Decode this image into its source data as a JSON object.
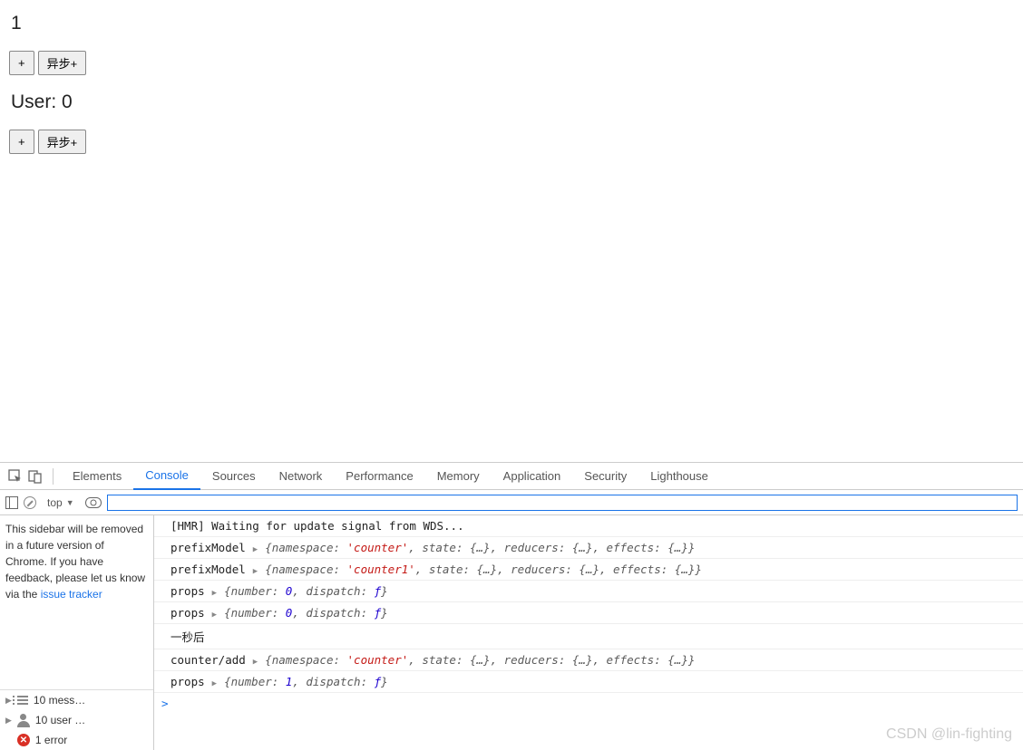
{
  "app": {
    "counter_value": "1",
    "counter_buttons": {
      "inc": "+",
      "async_inc": "异步+"
    },
    "user_label_prefix": "User: ",
    "user_value": "0",
    "user_buttons": {
      "inc": "+",
      "async_inc": "异步+"
    }
  },
  "devtools": {
    "tabs": [
      "Elements",
      "Console",
      "Sources",
      "Network",
      "Performance",
      "Memory",
      "Application",
      "Security",
      "Lighthouse"
    ],
    "active_tab": "Console",
    "toolbar": {
      "context_label": "top",
      "filter_value": ""
    },
    "sidebar": {
      "notice_text": "This sidebar will be removed in a future version of Chrome. If you have feedback, please let us know via the ",
      "notice_link": "issue tracker",
      "counts": {
        "messages": "10 mess…",
        "user": "10 user …",
        "errors": "1 error"
      }
    },
    "console_rows": [
      {
        "type": "plain",
        "text": "[HMR] Waiting for update signal from WDS..."
      },
      {
        "type": "obj",
        "label": "prefixModel",
        "preview": [
          [
            "key",
            "{namespace: "
          ],
          [
            "str",
            "'counter'"
          ],
          [
            "key",
            ", state: "
          ],
          [
            "punct",
            "{…}"
          ],
          [
            "key",
            ", reducers: "
          ],
          [
            "punct",
            "{…}"
          ],
          [
            "key",
            ", effects: "
          ],
          [
            "punct",
            "{…}"
          ],
          [
            "key",
            "}"
          ]
        ]
      },
      {
        "type": "obj",
        "label": "prefixModel",
        "preview": [
          [
            "key",
            "{namespace: "
          ],
          [
            "str",
            "'counter1'"
          ],
          [
            "key",
            ", state: "
          ],
          [
            "punct",
            "{…}"
          ],
          [
            "key",
            ", reducers: "
          ],
          [
            "punct",
            "{…}"
          ],
          [
            "key",
            ", effects: "
          ],
          [
            "punct",
            "{…}"
          ],
          [
            "key",
            "}"
          ]
        ]
      },
      {
        "type": "obj",
        "label": "props",
        "preview": [
          [
            "key",
            "{number: "
          ],
          [
            "num",
            "0"
          ],
          [
            "key",
            ", dispatch: "
          ],
          [
            "fn",
            "ƒ"
          ],
          [
            "key",
            "}"
          ]
        ]
      },
      {
        "type": "obj",
        "label": "props",
        "preview": [
          [
            "key",
            "{number: "
          ],
          [
            "num",
            "0"
          ],
          [
            "key",
            ", dispatch: "
          ],
          [
            "fn",
            "ƒ"
          ],
          [
            "key",
            "}"
          ]
        ]
      },
      {
        "type": "plain",
        "text": "一秒后"
      },
      {
        "type": "obj",
        "label": "counter/add",
        "preview": [
          [
            "key",
            "{namespace: "
          ],
          [
            "str",
            "'counter'"
          ],
          [
            "key",
            ", state: "
          ],
          [
            "punct",
            "{…}"
          ],
          [
            "key",
            ", reducers: "
          ],
          [
            "punct",
            "{…}"
          ],
          [
            "key",
            ", effects: "
          ],
          [
            "punct",
            "{…}"
          ],
          [
            "key",
            "}"
          ]
        ]
      },
      {
        "type": "obj",
        "label": "props",
        "preview": [
          [
            "key",
            "{number: "
          ],
          [
            "num",
            "1"
          ],
          [
            "key",
            ", dispatch: "
          ],
          [
            "fn",
            "ƒ"
          ],
          [
            "key",
            "}"
          ]
        ]
      }
    ],
    "prompt": ">"
  },
  "watermark": "CSDN @lin-fighting"
}
